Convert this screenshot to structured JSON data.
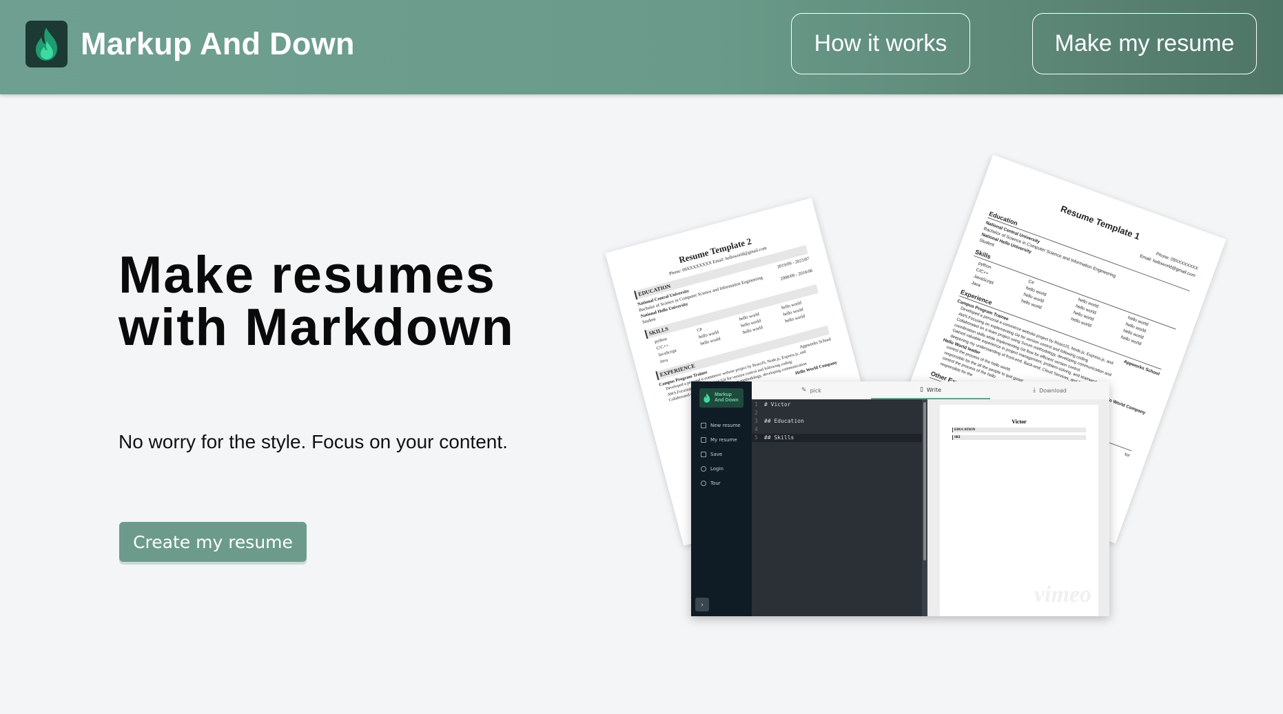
{
  "header": {
    "brand": "Markup And Down",
    "nav": {
      "how": "How it works",
      "make": "Make my resume"
    }
  },
  "hero": {
    "title": "Make resumes with Markdown",
    "subtitle": "No worry for the style. Focus on your content.",
    "cta": "Create my resume"
  },
  "colors": {
    "accent": "#6c9b8b",
    "header": "#6a9b8a",
    "logo_bg": "#1c3a33"
  },
  "illustration": {
    "template2": {
      "title": "Resume Template 2",
      "contact": "Phone: 09XXXXXXXX    Email: helloworld@gmail.com",
      "edu_header": "EDUCATION",
      "edu1_school": "National Central University",
      "edu1_dates": "2019/09 - 2023/07",
      "edu1_degree": "Bachelor of Science in Computer Science and Information Engineering",
      "edu2_school": "National Hello University",
      "edu2_dates": "2008/09 - 2016/06",
      "edu2_degree": "Student",
      "skills_header": "SKILLS",
      "skills": [
        "python",
        "C#",
        "hello world",
        "hello world",
        "C/C++",
        "hello world",
        "hello world",
        "hello world",
        "JavaScript",
        "hello world",
        "hello world",
        "hello world",
        "Java",
        "",
        "",
        ""
      ],
      "exp_header": "EXPERIENCE",
      "exp1_role": "Campus Program Trainee",
      "exp1_org": "Appworks School",
      "exp1_b1": "Developed a personal e-commerce website project by ReactJS, Node.js, Express.js, and",
      "exp1_b2": "AWS.Focusing on implementing Git for version control and following coding",
      "exp1_b3": "Collaborated on a team project using Scrum methodology, developing communication",
      "exp2_role": "Hello World Company"
    },
    "template1": {
      "title": "Resume Template 1",
      "phone": "Phone: 09XXXXXXXX",
      "email": "Email: helloworld@gmail.com",
      "edu_header": "Education",
      "edu1_school": "National Central University",
      "edu1_degree": "Bachelor of Science in Computer Science and Information Engineering",
      "edu2_school": "National Hello University",
      "edu2_degree": "Student",
      "skills_header": "Skills",
      "skills": [
        "python",
        "C#",
        "hello world",
        "hello world",
        "C/C++",
        "hello world",
        "hello world",
        "hello world",
        "JavaScript",
        "hello world",
        "hello world",
        "hello world",
        "Java",
        "hello world",
        "hello world",
        "hello world"
      ],
      "exp_header": "Experience",
      "exp1_role": "Campus Program Trainee",
      "exp1_org": "Appworks School",
      "exp1_b1": "Developed a personal e-commerce website project by ReactJS, Node.js, Express.js, and",
      "exp1_b2": "AWS.Focusing on implementing Git for version control and following coding",
      "exp1_b3": "Collaborated on a team project using Scrum methodology, developing communication and",
      "exp1_b4": "coordination skills while implementing Git flow for efficient version control.",
      "exp1_b5": "Gained valuable experience in project management, problem-solving, and teamwork while",
      "exp1_b6": "deepening my understanding of front-end, Back-end, Cloud Services, and DevOps.",
      "exp2_role": "Hello World leader",
      "exp2_org": "Hello World Company",
      "exp2_b1": "control the process of the hello world.",
      "exp2_b2": "responsible for the all the people to quit googl",
      "exp2_b3": "control the process of the hello",
      "exp2_b4": "responsible for the",
      "other_header": "Other Expe",
      "other_frag": "tor"
    },
    "app": {
      "logo_line1": "Markup",
      "logo_line2": "And Down",
      "sidebar": [
        "New resume",
        "My resume",
        "Save",
        "Login",
        "Tour"
      ],
      "tabs": [
        "pick",
        "Write",
        "Download"
      ],
      "editor_lines": [
        {
          "num": "1",
          "text": "# Victor"
        },
        {
          "num": "2",
          "text": ""
        },
        {
          "num": "3",
          "text": "## Education"
        },
        {
          "num": "4",
          "text": ""
        },
        {
          "num": "5",
          "text": "## Skills"
        }
      ],
      "preview_name": "Victor",
      "preview_sections": [
        "EDUCATION",
        "SKI"
      ],
      "watermark": "vimeo"
    }
  }
}
